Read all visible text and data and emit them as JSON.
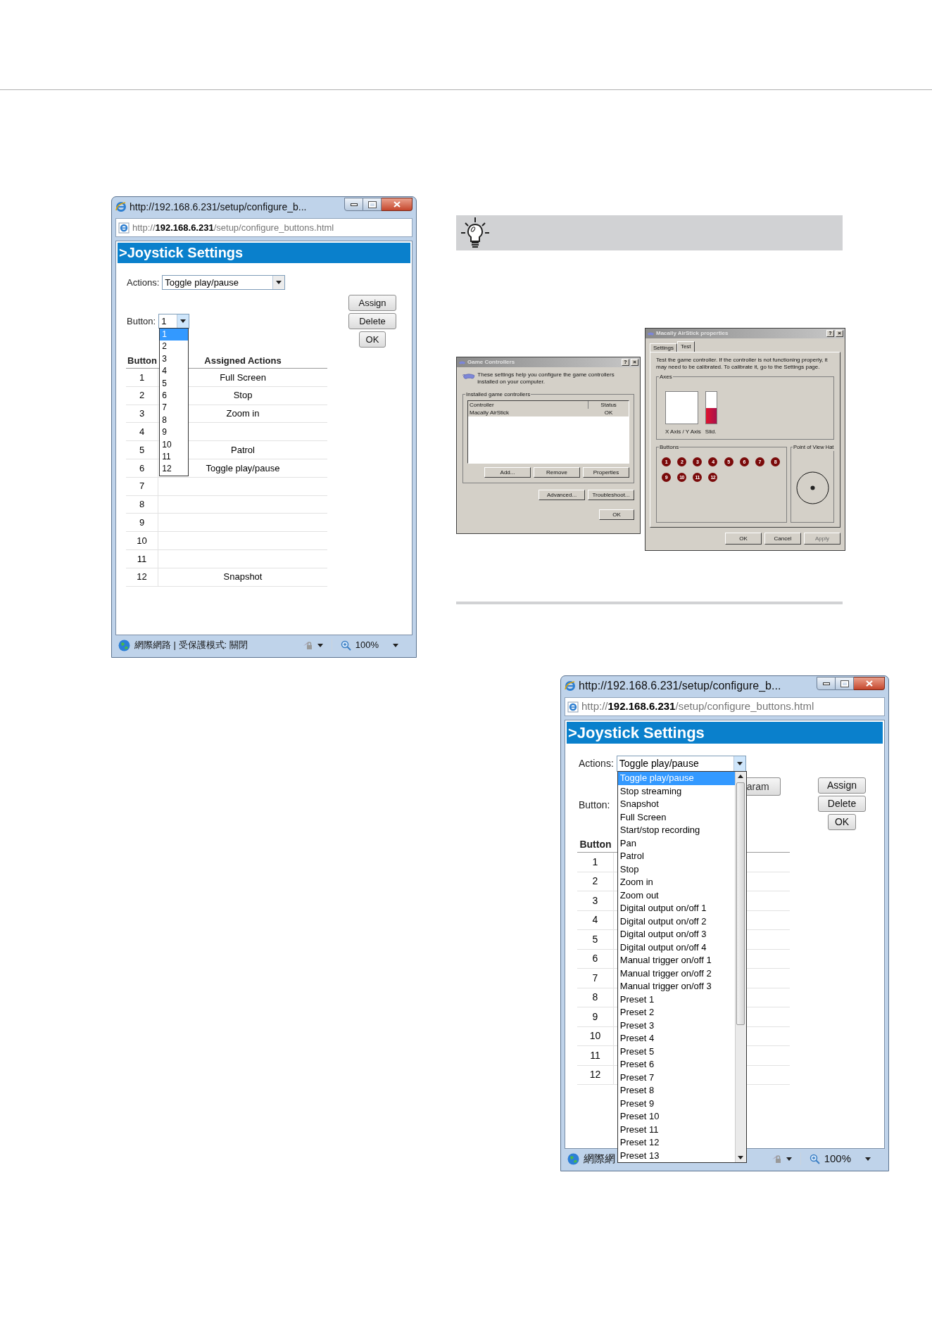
{
  "settings_window_button_list": {
    "title": "http://192.168.6.231/setup/configure_b...",
    "address": "http://**192.168.6.231**/setup/configure_buttons.html",
    "heading": ">Joystick Settings",
    "actions": {
      "label": "Actions:",
      "value": "Toggle play/pause"
    },
    "button_field": {
      "label": "Button:",
      "value": "1"
    },
    "action_buttons": [
      "Assign",
      "Delete",
      "OK"
    ],
    "table": {
      "columns": [
        "Button",
        "Assigned Actions"
      ],
      "rows": [
        {
          "cells": [
            "1",
            "Full Screen"
          ]
        },
        {
          "cells": [
            "2",
            "Stop"
          ]
        },
        {
          "cells": [
            "3",
            "Zoom in"
          ]
        },
        {
          "cells": [
            "4"
          ]
        },
        {
          "cells": [
            "5",
            "Patrol"
          ]
        },
        {
          "cells": [
            "6",
            "Toggle play/pause"
          ]
        },
        {
          "cells": [
            "7"
          ]
        },
        {
          "cells": [
            "8"
          ]
        },
        {
          "cells": [
            "9"
          ]
        },
        {
          "cells": [
            "10"
          ]
        },
        {
          "cells": [
            "11"
          ]
        },
        {
          "cells": [
            "12",
            "Snapshot"
          ]
        }
      ]
    },
    "dropdown": {
      "kind": "button",
      "options": [
        {
          "label": "1",
          "selected": true
        },
        {
          "label": "2",
          "selected": false
        },
        {
          "label": "3",
          "selected": false
        },
        {
          "label": "4",
          "selected": false
        },
        {
          "label": "5",
          "selected": false
        },
        {
          "label": "6",
          "selected": false
        },
        {
          "label": "7",
          "selected": false
        },
        {
          "label": "8",
          "selected": false
        },
        {
          "label": "9",
          "selected": false
        },
        {
          "label": "10",
          "selected": false
        },
        {
          "label": "11",
          "selected": false
        },
        {
          "label": "12",
          "selected": false
        }
      ]
    },
    "status_bar": {
      "zone": "網際網路 | 受保護模式: 關閉",
      "zoom": "100%"
    }
  },
  "game_controllers_dialog": {
    "title": "Game Controllers",
    "help_glyph": "?",
    "close_glyph": "×",
    "description": "These settings help you configure the game controllers installed on your computer.",
    "group_legend": "Installed game controllers",
    "columns": [
      "Controller",
      "Status"
    ],
    "rows": [
      {
        "controller": "Macally AirStick",
        "status": "OK",
        "selected": true
      }
    ],
    "list_buttons": [
      "Add...",
      "Remove",
      "Properties"
    ],
    "lower_buttons": [
      "Advanced...",
      "Troubleshoot..."
    ],
    "ok_button": "OK"
  },
  "properties_dialog": {
    "title": "Macally AirStick properties",
    "help_glyph": "?",
    "close_glyph": "×",
    "tabs": [
      {
        "label": "Settings",
        "selected": false
      },
      {
        "label": "Test",
        "selected": true
      }
    ],
    "description": "Test the game controller. If the controller is not functioning properly, it may need to be calibrated. To calibrate it, go to the Settings page.",
    "axes": {
      "legend": "Axes",
      "xy_label": "X Axis / Y Axis",
      "slider_label": "Slid.",
      "slider": {
        "level": 0.5
      }
    },
    "buttons_group": {
      "legend": "Buttons",
      "buttons": [
        "1",
        "2",
        "3",
        "4",
        "5",
        "6",
        "7",
        "8",
        "9",
        "10",
        "11",
        "12"
      ]
    },
    "pov": {
      "legend": "Point of View Hat"
    },
    "dialog_buttons": [
      {
        "label": "OK",
        "disabled": false
      },
      {
        "label": "Cancel",
        "disabled": false
      },
      {
        "label": "Apply",
        "disabled": true
      }
    ]
  },
  "settings_window_actions_list": {
    "title": "http://192.168.6.231/setup/configure_b...",
    "address": "http://**192.168.6.231**/setup/configure_buttons.html",
    "heading": ">Joystick Settings",
    "actions": {
      "label": "Actions:",
      "value": "Toggle play/pause"
    },
    "param_button": "aram",
    "button_field": {
      "label": "Button:"
    },
    "action_buttons": [
      "Assign",
      "Delete",
      "OK"
    ],
    "table": {
      "columns": [
        "Button"
      ],
      "rows": [
        {
          "cells": [
            "1"
          ]
        },
        {
          "cells": [
            "2"
          ]
        },
        {
          "cells": [
            "3"
          ]
        },
        {
          "cells": [
            "4"
          ]
        },
        {
          "cells": [
            "5"
          ]
        },
        {
          "cells": [
            "6"
          ]
        },
        {
          "cells": [
            "7"
          ]
        },
        {
          "cells": [
            "8"
          ]
        },
        {
          "cells": [
            "9"
          ]
        },
        {
          "cells": [
            "10"
          ]
        },
        {
          "cells": [
            "11"
          ]
        },
        {
          "cells": [
            "12"
          ]
        }
      ]
    },
    "dropdown": {
      "kind": "actions",
      "options": [
        {
          "label": "Toggle play/pause",
          "selected": true
        },
        {
          "label": "Stop streaming",
          "selected": false
        },
        {
          "label": "Snapshot",
          "selected": false
        },
        {
          "label": "Full Screen",
          "selected": false
        },
        {
          "label": "Start/stop recording",
          "selected": false
        },
        {
          "label": "Pan",
          "selected": false
        },
        {
          "label": "Patrol",
          "selected": false
        },
        {
          "label": "Stop",
          "selected": false
        },
        {
          "label": "Zoom in",
          "selected": false
        },
        {
          "label": "Zoom out",
          "selected": false
        },
        {
          "label": "Digital output on/off 1",
          "selected": false
        },
        {
          "label": "Digital output on/off 2",
          "selected": false
        },
        {
          "label": "Digital output on/off 3",
          "selected": false
        },
        {
          "label": "Digital output on/off 4",
          "selected": false
        },
        {
          "label": "Manual trigger on/off 1",
          "selected": false
        },
        {
          "label": "Manual trigger on/off 2",
          "selected": false
        },
        {
          "label": "Manual trigger on/off 3",
          "selected": false
        },
        {
          "label": "Preset 1",
          "selected": false
        },
        {
          "label": "Preset 2",
          "selected": false
        },
        {
          "label": "Preset 3",
          "selected": false
        },
        {
          "label": "Preset 4",
          "selected": false
        },
        {
          "label": "Preset 5",
          "selected": false
        },
        {
          "label": "Preset 6",
          "selected": false
        },
        {
          "label": "Preset 7",
          "selected": false
        },
        {
          "label": "Preset 8",
          "selected": false
        },
        {
          "label": "Preset 9",
          "selected": false
        },
        {
          "label": "Preset 10",
          "selected": false
        },
        {
          "label": "Preset 11",
          "selected": false
        },
        {
          "label": "Preset 12",
          "selected": false
        },
        {
          "label": "Preset 13",
          "selected": false
        }
      ]
    },
    "status_bar": {
      "zone": "網際網",
      "zoom": "100%"
    }
  }
}
